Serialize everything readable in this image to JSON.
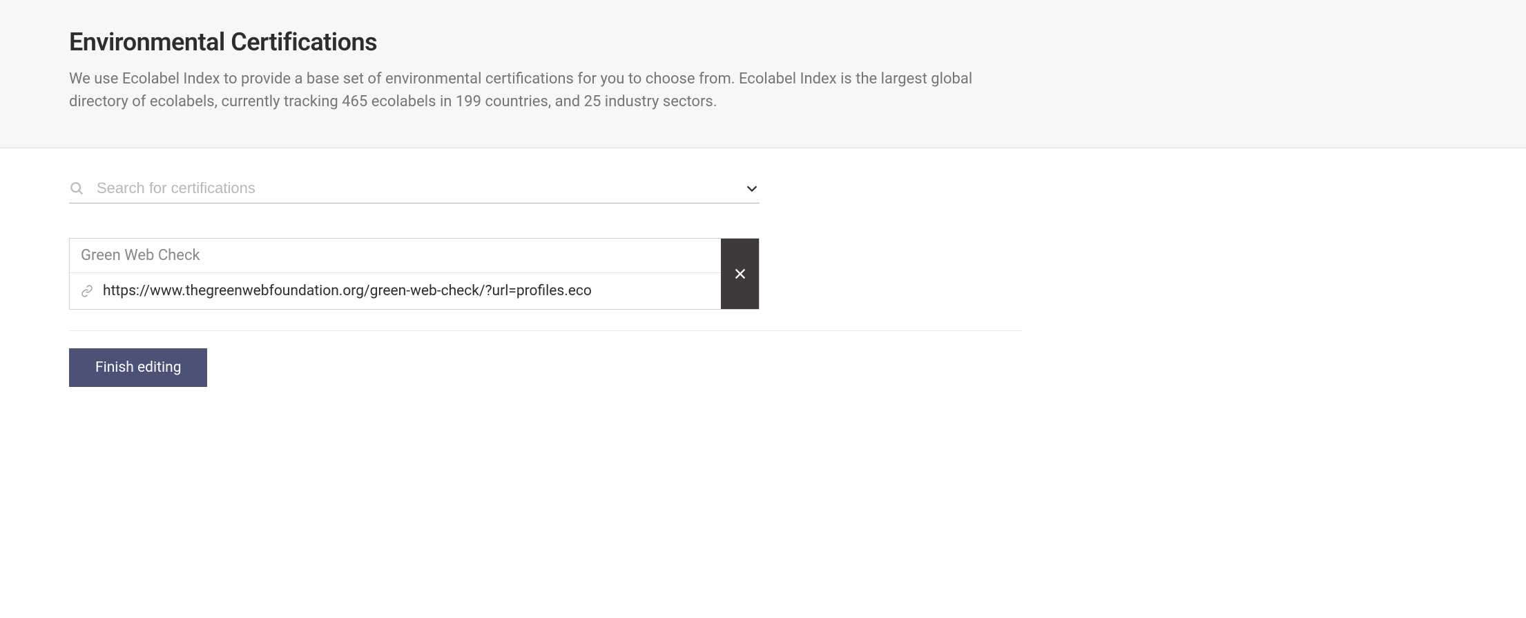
{
  "header": {
    "title": "Environmental Certifications",
    "description": "We use Ecolabel Index to provide a base set of environmental certifications for you to choose from. Ecolabel Index is the largest global directory of ecolabels, currently tracking 465 ecolabels in 199 countries, and 25 industry sectors."
  },
  "search": {
    "placeholder": "Search for certifications"
  },
  "certifications": [
    {
      "name": "Green Web Check",
      "url": "https://www.thegreenwebfoundation.org/green-web-check/?url=profiles.eco"
    }
  ],
  "actions": {
    "finish_label": "Finish editing"
  }
}
